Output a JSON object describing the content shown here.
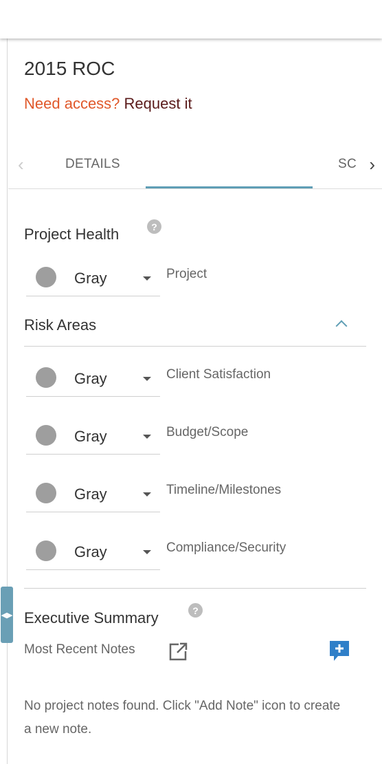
{
  "header": {
    "title": "2015 ROC",
    "access_prompt": "Need access?",
    "access_link": "Request it"
  },
  "tabs": {
    "items": [
      {
        "label": "DETAILS"
      },
      {
        "label": ""
      },
      {
        "label": "SC"
      }
    ],
    "active_index": 1
  },
  "project_health": {
    "title": "Project Health",
    "help": "?",
    "status": {
      "value": "Gray",
      "label": "Project",
      "color": "#9e9e9e"
    }
  },
  "risk_areas": {
    "title": "Risk Areas",
    "items": [
      {
        "value": "Gray",
        "label": "Client Satisfaction",
        "color": "#9e9e9e"
      },
      {
        "value": "Gray",
        "label": "Budget/Scope",
        "color": "#9e9e9e"
      },
      {
        "value": "Gray",
        "label": "Timeline/Milestones",
        "color": "#9e9e9e"
      },
      {
        "value": "Gray",
        "label": "Compliance/Security",
        "color": "#9e9e9e"
      }
    ]
  },
  "executive_summary": {
    "title": "Executive Summary",
    "help": "?",
    "notes_label": "Most Recent Notes",
    "empty_message": "No project notes found. Click \"Add Note\" icon to create a new note."
  },
  "colors": {
    "accent": "#5f9eb5",
    "access_prompt": "#e0582a",
    "access_link": "#5a1a1a",
    "add_note": "#2f7fc8"
  }
}
